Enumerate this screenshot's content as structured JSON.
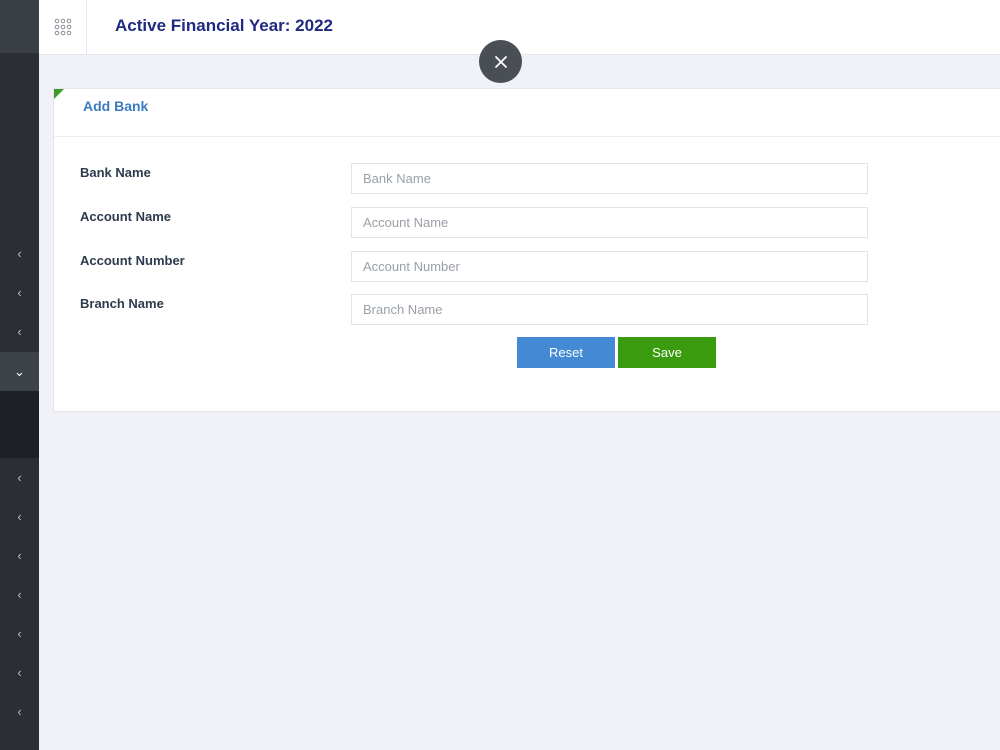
{
  "header": {
    "title": "Active Financial Year: 2022"
  },
  "sidebar": {
    "items": [
      {
        "icon": "chevron-left-icon",
        "glyph": "‹"
      },
      {
        "icon": "chevron-left-icon",
        "glyph": "‹"
      },
      {
        "icon": "chevron-left-icon",
        "glyph": "‹"
      },
      {
        "icon": "chevron-down-icon",
        "glyph": "⌄",
        "active": true
      },
      {
        "icon": "chevron-left-icon",
        "glyph": "‹"
      },
      {
        "icon": "chevron-left-icon",
        "glyph": "‹"
      },
      {
        "icon": "chevron-left-icon",
        "glyph": "‹"
      },
      {
        "icon": "chevron-left-icon",
        "glyph": "‹"
      },
      {
        "icon": "chevron-left-icon",
        "glyph": "‹"
      },
      {
        "icon": "chevron-left-icon",
        "glyph": "‹"
      },
      {
        "icon": "chevron-left-icon",
        "glyph": "‹"
      }
    ]
  },
  "form": {
    "title": "Add Bank",
    "fields": [
      {
        "label": "Bank Name",
        "placeholder": "Bank Name",
        "value": ""
      },
      {
        "label": "Account Name",
        "placeholder": "Account Name",
        "value": ""
      },
      {
        "label": "Account Number",
        "placeholder": "Account Number",
        "value": ""
      },
      {
        "label": "Branch Name",
        "placeholder": "Branch Name",
        "value": ""
      }
    ],
    "reset_label": "Reset",
    "save_label": "Save"
  },
  "colors": {
    "title": "#1f2a80",
    "card_title": "#3b7bbf",
    "reset": "#4389d3",
    "save": "#3b9b0f",
    "sidebar": "#2b2f35"
  }
}
